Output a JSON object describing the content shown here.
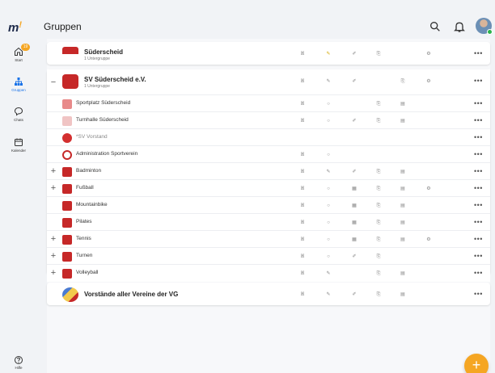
{
  "app": {
    "title": "Gruppen"
  },
  "sidebar": {
    "items": [
      {
        "label": "Start",
        "badge": "19"
      },
      {
        "label": "Gruppen"
      },
      {
        "label": "Chats"
      },
      {
        "label": "Kalender"
      }
    ],
    "help_label": "Hilfe"
  },
  "groups": [
    {
      "name": "Süderscheid",
      "sub": "1 Untergruppe"
    },
    {
      "name": "SV Süderscheid e.V.",
      "sub": "1 Untergruppe",
      "children": [
        "Sportplatz Süderscheid",
        "Turnhalle Süderscheid",
        "*SV Vorstand",
        "Administration Sportverein",
        "Badminton",
        "Fußball",
        "Mountainbike",
        "Pilates",
        "Tennis",
        "Turnen",
        "Volleyball"
      ]
    },
    {
      "name": "Vorstände aller Vereine der VG"
    }
  ],
  "colors": {
    "accent": "#f5a623",
    "primary": "#1a73e8",
    "club_red": "#c62828"
  }
}
